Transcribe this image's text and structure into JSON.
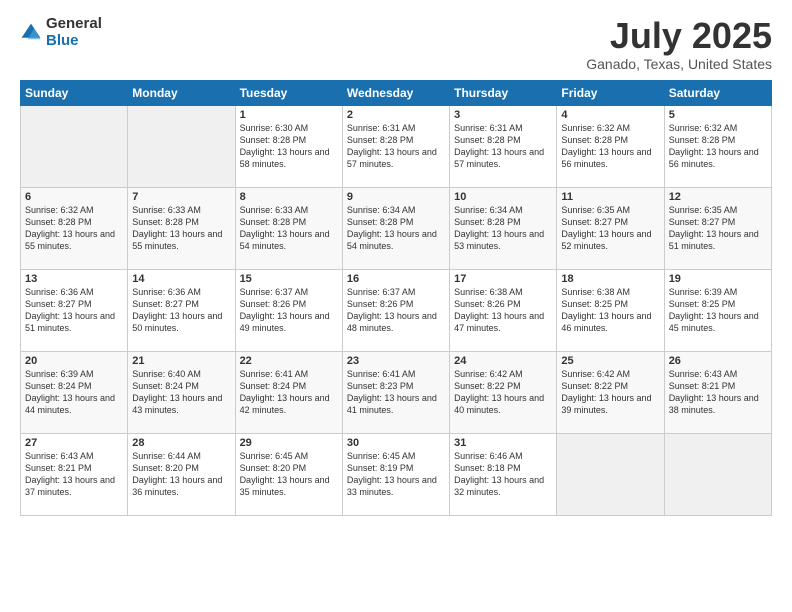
{
  "logo": {
    "general": "General",
    "blue": "Blue"
  },
  "title": "July 2025",
  "subtitle": "Ganado, Texas, United States",
  "weekdays": [
    "Sunday",
    "Monday",
    "Tuesday",
    "Wednesday",
    "Thursday",
    "Friday",
    "Saturday"
  ],
  "weeks": [
    [
      {
        "day": "",
        "sunrise": "",
        "sunset": "",
        "daylight": ""
      },
      {
        "day": "",
        "sunrise": "",
        "sunset": "",
        "daylight": ""
      },
      {
        "day": "1",
        "sunrise": "Sunrise: 6:30 AM",
        "sunset": "Sunset: 8:28 PM",
        "daylight": "Daylight: 13 hours and 58 minutes."
      },
      {
        "day": "2",
        "sunrise": "Sunrise: 6:31 AM",
        "sunset": "Sunset: 8:28 PM",
        "daylight": "Daylight: 13 hours and 57 minutes."
      },
      {
        "day": "3",
        "sunrise": "Sunrise: 6:31 AM",
        "sunset": "Sunset: 8:28 PM",
        "daylight": "Daylight: 13 hours and 57 minutes."
      },
      {
        "day": "4",
        "sunrise": "Sunrise: 6:32 AM",
        "sunset": "Sunset: 8:28 PM",
        "daylight": "Daylight: 13 hours and 56 minutes."
      },
      {
        "day": "5",
        "sunrise": "Sunrise: 6:32 AM",
        "sunset": "Sunset: 8:28 PM",
        "daylight": "Daylight: 13 hours and 56 minutes."
      }
    ],
    [
      {
        "day": "6",
        "sunrise": "Sunrise: 6:32 AM",
        "sunset": "Sunset: 8:28 PM",
        "daylight": "Daylight: 13 hours and 55 minutes."
      },
      {
        "day": "7",
        "sunrise": "Sunrise: 6:33 AM",
        "sunset": "Sunset: 8:28 PM",
        "daylight": "Daylight: 13 hours and 55 minutes."
      },
      {
        "day": "8",
        "sunrise": "Sunrise: 6:33 AM",
        "sunset": "Sunset: 8:28 PM",
        "daylight": "Daylight: 13 hours and 54 minutes."
      },
      {
        "day": "9",
        "sunrise": "Sunrise: 6:34 AM",
        "sunset": "Sunset: 8:28 PM",
        "daylight": "Daylight: 13 hours and 54 minutes."
      },
      {
        "day": "10",
        "sunrise": "Sunrise: 6:34 AM",
        "sunset": "Sunset: 8:28 PM",
        "daylight": "Daylight: 13 hours and 53 minutes."
      },
      {
        "day": "11",
        "sunrise": "Sunrise: 6:35 AM",
        "sunset": "Sunset: 8:27 PM",
        "daylight": "Daylight: 13 hours and 52 minutes."
      },
      {
        "day": "12",
        "sunrise": "Sunrise: 6:35 AM",
        "sunset": "Sunset: 8:27 PM",
        "daylight": "Daylight: 13 hours and 51 minutes."
      }
    ],
    [
      {
        "day": "13",
        "sunrise": "Sunrise: 6:36 AM",
        "sunset": "Sunset: 8:27 PM",
        "daylight": "Daylight: 13 hours and 51 minutes."
      },
      {
        "day": "14",
        "sunrise": "Sunrise: 6:36 AM",
        "sunset": "Sunset: 8:27 PM",
        "daylight": "Daylight: 13 hours and 50 minutes."
      },
      {
        "day": "15",
        "sunrise": "Sunrise: 6:37 AM",
        "sunset": "Sunset: 8:26 PM",
        "daylight": "Daylight: 13 hours and 49 minutes."
      },
      {
        "day": "16",
        "sunrise": "Sunrise: 6:37 AM",
        "sunset": "Sunset: 8:26 PM",
        "daylight": "Daylight: 13 hours and 48 minutes."
      },
      {
        "day": "17",
        "sunrise": "Sunrise: 6:38 AM",
        "sunset": "Sunset: 8:26 PM",
        "daylight": "Daylight: 13 hours and 47 minutes."
      },
      {
        "day": "18",
        "sunrise": "Sunrise: 6:38 AM",
        "sunset": "Sunset: 8:25 PM",
        "daylight": "Daylight: 13 hours and 46 minutes."
      },
      {
        "day": "19",
        "sunrise": "Sunrise: 6:39 AM",
        "sunset": "Sunset: 8:25 PM",
        "daylight": "Daylight: 13 hours and 45 minutes."
      }
    ],
    [
      {
        "day": "20",
        "sunrise": "Sunrise: 6:39 AM",
        "sunset": "Sunset: 8:24 PM",
        "daylight": "Daylight: 13 hours and 44 minutes."
      },
      {
        "day": "21",
        "sunrise": "Sunrise: 6:40 AM",
        "sunset": "Sunset: 8:24 PM",
        "daylight": "Daylight: 13 hours and 43 minutes."
      },
      {
        "day": "22",
        "sunrise": "Sunrise: 6:41 AM",
        "sunset": "Sunset: 8:24 PM",
        "daylight": "Daylight: 13 hours and 42 minutes."
      },
      {
        "day": "23",
        "sunrise": "Sunrise: 6:41 AM",
        "sunset": "Sunset: 8:23 PM",
        "daylight": "Daylight: 13 hours and 41 minutes."
      },
      {
        "day": "24",
        "sunrise": "Sunrise: 6:42 AM",
        "sunset": "Sunset: 8:22 PM",
        "daylight": "Daylight: 13 hours and 40 minutes."
      },
      {
        "day": "25",
        "sunrise": "Sunrise: 6:42 AM",
        "sunset": "Sunset: 8:22 PM",
        "daylight": "Daylight: 13 hours and 39 minutes."
      },
      {
        "day": "26",
        "sunrise": "Sunrise: 6:43 AM",
        "sunset": "Sunset: 8:21 PM",
        "daylight": "Daylight: 13 hours and 38 minutes."
      }
    ],
    [
      {
        "day": "27",
        "sunrise": "Sunrise: 6:43 AM",
        "sunset": "Sunset: 8:21 PM",
        "daylight": "Daylight: 13 hours and 37 minutes."
      },
      {
        "day": "28",
        "sunrise": "Sunrise: 6:44 AM",
        "sunset": "Sunset: 8:20 PM",
        "daylight": "Daylight: 13 hours and 36 minutes."
      },
      {
        "day": "29",
        "sunrise": "Sunrise: 6:45 AM",
        "sunset": "Sunset: 8:20 PM",
        "daylight": "Daylight: 13 hours and 35 minutes."
      },
      {
        "day": "30",
        "sunrise": "Sunrise: 6:45 AM",
        "sunset": "Sunset: 8:19 PM",
        "daylight": "Daylight: 13 hours and 33 minutes."
      },
      {
        "day": "31",
        "sunrise": "Sunrise: 6:46 AM",
        "sunset": "Sunset: 8:18 PM",
        "daylight": "Daylight: 13 hours and 32 minutes."
      },
      {
        "day": "",
        "sunrise": "",
        "sunset": "",
        "daylight": ""
      },
      {
        "day": "",
        "sunrise": "",
        "sunset": "",
        "daylight": ""
      }
    ]
  ]
}
